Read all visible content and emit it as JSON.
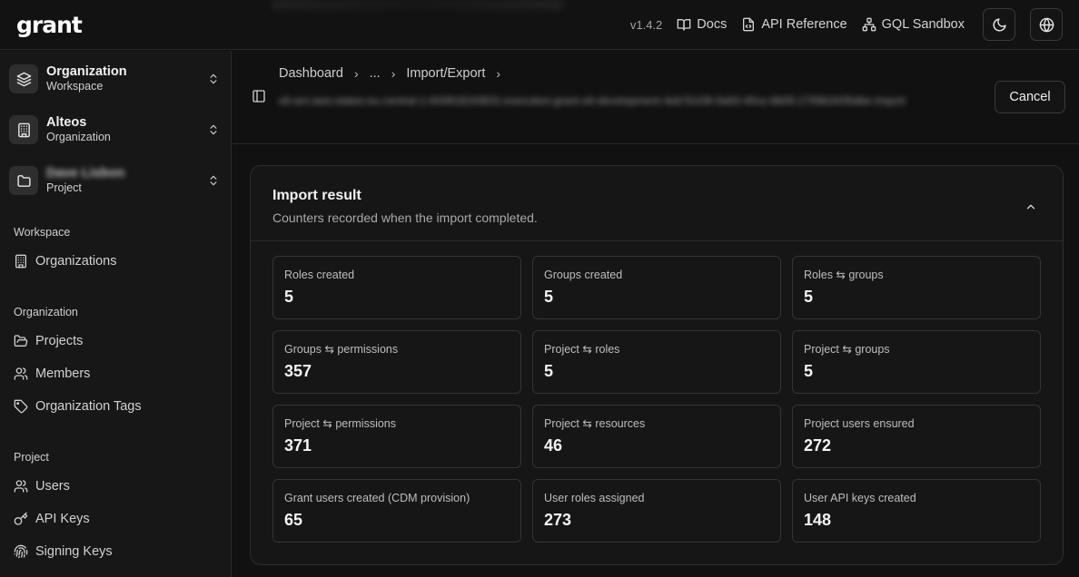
{
  "app": {
    "logo": "grant",
    "version": "v1.4.2",
    "nav": [
      {
        "label": "Docs",
        "icon": "book-icon"
      },
      {
        "label": "API Reference",
        "icon": "file-code-icon"
      },
      {
        "label": "GQL Sandbox",
        "icon": "network-icon"
      }
    ],
    "theme_toggle_icon": "moon-icon",
    "language_icon": "globe-icon"
  },
  "sidebar": {
    "switchers": [
      {
        "title": "Organization",
        "subtitle": "Workspace",
        "icon": "layers-icon"
      },
      {
        "title": "Alteos",
        "subtitle": "Organization",
        "icon": "building-icon"
      },
      {
        "title": "Dave Lisbon",
        "subtitle": "Project",
        "icon": "folder-icon"
      }
    ],
    "sections": [
      {
        "label": "Workspace",
        "items": [
          {
            "label": "Organizations",
            "icon": "building-icon"
          }
        ]
      },
      {
        "label": "Organization",
        "items": [
          {
            "label": "Projects",
            "icon": "folder-open-icon"
          },
          {
            "label": "Members",
            "icon": "users-icon"
          },
          {
            "label": "Organization Tags",
            "icon": "tag-icon"
          }
        ]
      },
      {
        "label": "Project",
        "items": [
          {
            "label": "Users",
            "icon": "users-icon"
          },
          {
            "label": "API Keys",
            "icon": "key-icon"
          },
          {
            "label": "Signing Keys",
            "icon": "fingerprint-icon"
          }
        ]
      }
    ]
  },
  "header": {
    "breadcrumb": [
      "Dashboard",
      "...",
      "Import/Export"
    ],
    "subtitle": "etl-arn:aws:states:eu-central-1:443918243631:execution:grant-etl-development-4eb7b109-0a63-45ce-8b00-2769b3435dbe-import",
    "cancel_label": "Cancel"
  },
  "card": {
    "title": "Import result",
    "description": "Counters recorded when the import completed.",
    "stats": [
      {
        "label": "Roles created",
        "value": "5"
      },
      {
        "label": "Groups created",
        "value": "5"
      },
      {
        "label": "Roles ⇆ groups",
        "value": "5"
      },
      {
        "label": "Groups ⇆ permissions",
        "value": "357"
      },
      {
        "label": "Project ⇆ roles",
        "value": "5"
      },
      {
        "label": "Project ⇆ groups",
        "value": "5"
      },
      {
        "label": "Project ⇆ permissions",
        "value": "371"
      },
      {
        "label": "Project ⇆ resources",
        "value": "46"
      },
      {
        "label": "Project users ensured",
        "value": "272"
      },
      {
        "label": "Grant users created (CDM provision)",
        "value": "65"
      },
      {
        "label": "User roles assigned",
        "value": "273"
      },
      {
        "label": "User API keys created",
        "value": "148"
      }
    ]
  }
}
